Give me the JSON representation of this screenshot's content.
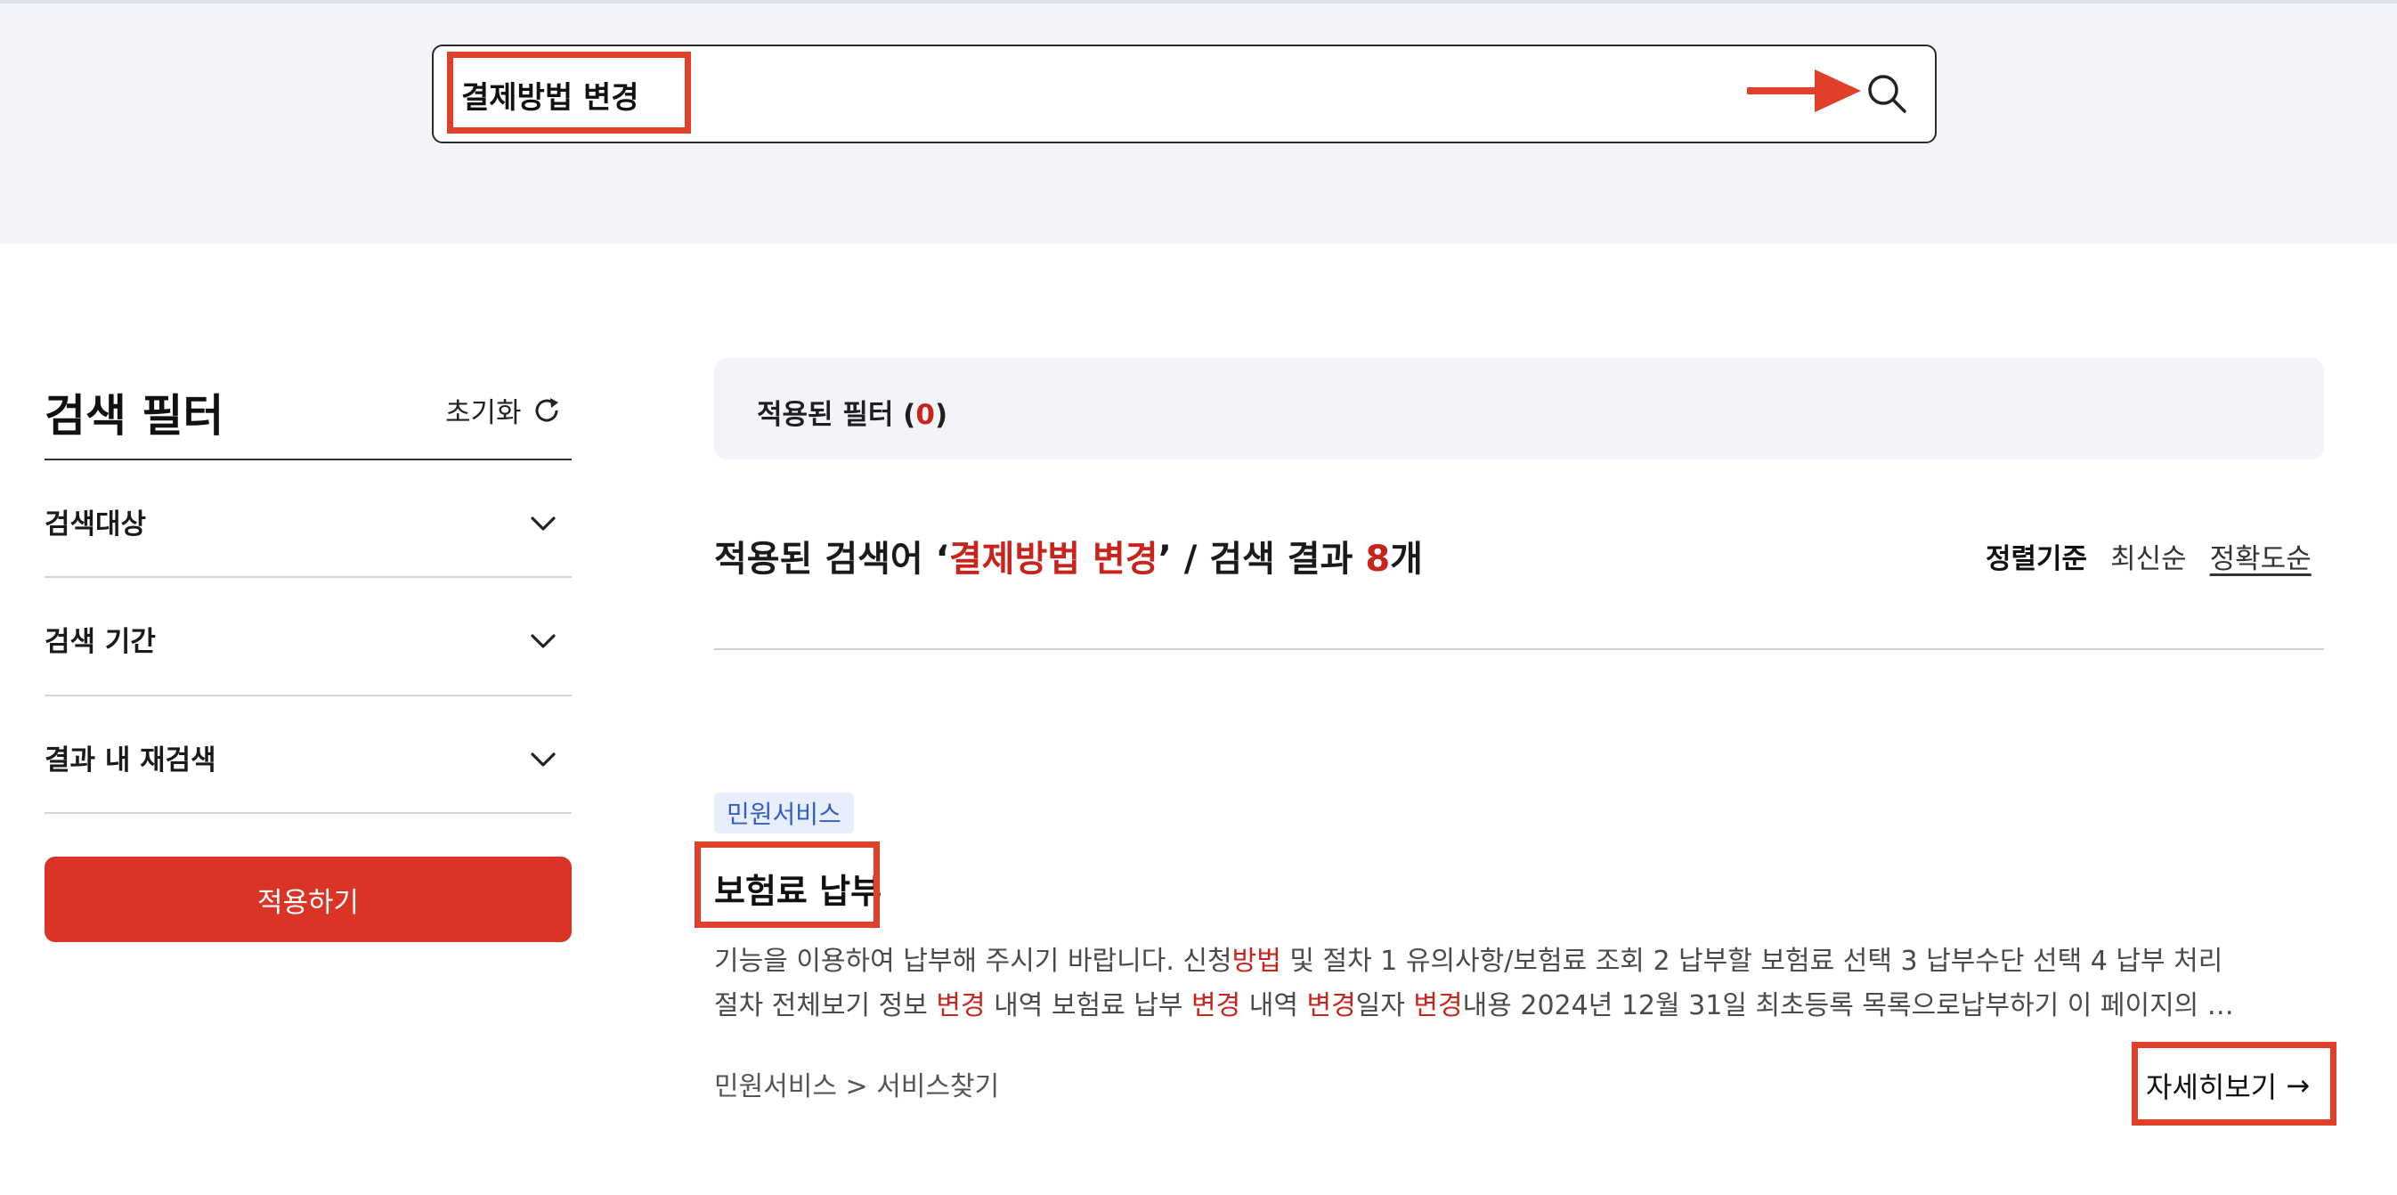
{
  "search": {
    "value": "결제방법 변경"
  },
  "filter": {
    "title": "검색 필터",
    "reset_label": "초기화",
    "sections": [
      "검색대상",
      "검색 기간",
      "결과 내 재검색"
    ],
    "apply_label": "적용하기"
  },
  "applied": {
    "prefix": "적용된 필터 (",
    "count": "0",
    "suffix": ")"
  },
  "result_header": {
    "prefix": "적용된 검색어 ‘",
    "keyword": "결제방법 변경",
    "middle": "’ / 검색 결과 ",
    "count": "8",
    "suffix": "개"
  },
  "sort": {
    "label": "정렬기준",
    "options": [
      "최신순",
      "정확도순"
    ],
    "active": "정확도순"
  },
  "result": {
    "tag": "민원서비스",
    "title": "보험료 납부",
    "snippet_line1": [
      {
        "t": "기능을 이용하여 납부해 주시기 바랍니다. 신청",
        "hl": false
      },
      {
        "t": "방법",
        "hl": true
      },
      {
        "t": " 및 절차 1 유의사항/보험료 조회 2 납부할 보험료 선택 3 납부수단 선택 4 납부 처리",
        "hl": false
      }
    ],
    "snippet_line2": [
      {
        "t": "절차 전체보기 정보 ",
        "hl": false
      },
      {
        "t": "변경",
        "hl": true
      },
      {
        "t": " 내역 보험료 납부 ",
        "hl": false
      },
      {
        "t": "변경",
        "hl": true
      },
      {
        "t": " 내역 ",
        "hl": false
      },
      {
        "t": "변경",
        "hl": true
      },
      {
        "t": "일자 ",
        "hl": false
      },
      {
        "t": "변경",
        "hl": true
      },
      {
        "t": "내용 2024년 12월 31일 최초등록 목록으로납부하기 이 페이지의 …",
        "hl": false
      }
    ],
    "path": "민원서비스 > 서비스찾기",
    "detail_label": "자세히보기",
    "detail_arrow": "→"
  },
  "colors": {
    "accent_red": "#d93426",
    "highlight_box": "#e0402a",
    "keyword_red": "#c8241b"
  }
}
